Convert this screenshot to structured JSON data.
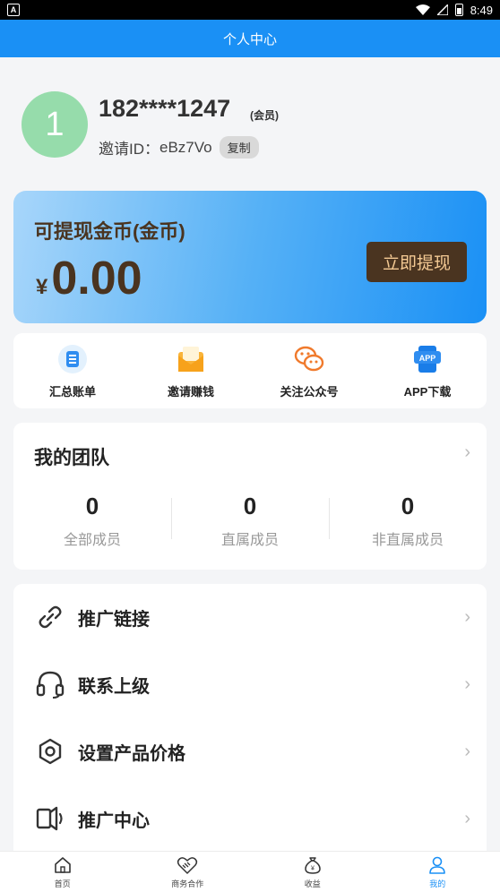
{
  "status_bar": {
    "time": "8:49",
    "app_icon": "A"
  },
  "header": {
    "title": "个人中心"
  },
  "profile": {
    "avatar_text": "1",
    "phone": "182****1247",
    "role": "(会员)",
    "invite_label": "邀请ID：",
    "invite_id": "eBz7Vo",
    "copy_label": "复制"
  },
  "coin_card": {
    "title": "可提现金币(金币)",
    "currency_symbol": "¥",
    "amount": "0.00",
    "withdraw_label": "立即提现"
  },
  "quick_actions": [
    {
      "label": "汇总账单",
      "icon": "bill-icon"
    },
    {
      "label": "邀请赚钱",
      "icon": "envelope-icon"
    },
    {
      "label": "关注公众号",
      "icon": "wechat-icon"
    },
    {
      "label": "APP下载",
      "icon": "app-download-icon",
      "badge": "APP"
    }
  ],
  "team": {
    "title": "我的团队",
    "stats": [
      {
        "value": "0",
        "label": "全部成员"
      },
      {
        "value": "0",
        "label": "直属成员"
      },
      {
        "value": "0",
        "label": "非直属成员"
      }
    ]
  },
  "menu": [
    {
      "label": "推广链接",
      "icon": "link-icon"
    },
    {
      "label": "联系上级",
      "icon": "headset-icon"
    },
    {
      "label": "设置产品价格",
      "icon": "settings-icon"
    },
    {
      "label": "推广中心",
      "icon": "speaker-icon"
    }
  ],
  "tabbar": [
    {
      "label": "首页",
      "icon": "home-icon"
    },
    {
      "label": "商务合作",
      "icon": "handshake-icon"
    },
    {
      "label": "收益",
      "icon": "money-bag-icon",
      "glyph": "¥"
    },
    {
      "label": "我的",
      "icon": "user-icon",
      "active": true
    }
  ],
  "colors": {
    "primary": "#1a90f5",
    "brown": "#4a3420",
    "gold": "#f4ca94",
    "avatar_bg": "#96dcab"
  }
}
